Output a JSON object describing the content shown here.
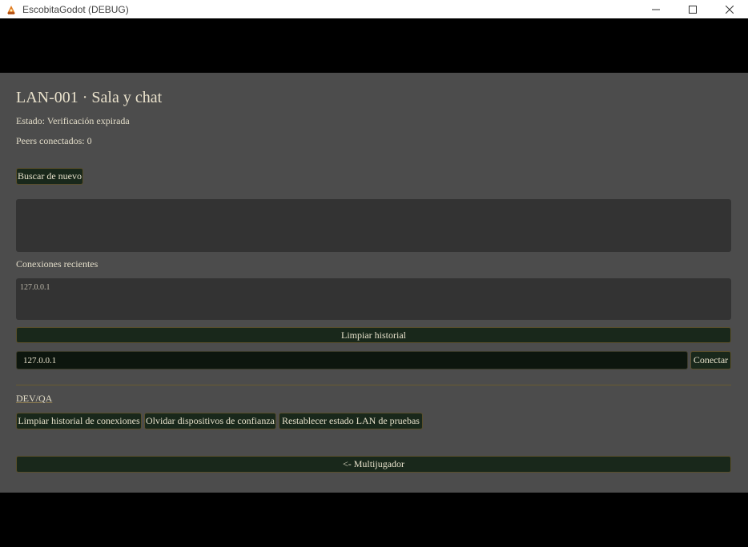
{
  "window": {
    "title": "EscobitaGodot (DEBUG)",
    "app_icon": "godot-app-icon",
    "controls": {
      "minimize": "minimize-icon",
      "maximize": "maximize-icon",
      "close": "close-icon"
    }
  },
  "lobby": {
    "title": "LAN-001 · Sala y chat",
    "status": "Estado: Verificación expirada",
    "peers": "Peers conectados: 0",
    "search_again_label": "Buscar de nuevo",
    "log_text": ""
  },
  "recent": {
    "label": "Conexiones recientes",
    "items": [
      "127.0.0.1"
    ],
    "clear_label": "Limpiar historial"
  },
  "connect": {
    "address_value": "127.0.0.1",
    "connect_label": "Conectar"
  },
  "devqa": {
    "label": "DEV/QA",
    "clear_connections_label": "Limpiar historial de conexiones",
    "forget_devices_label": "Olvidar dispositivos de confianza",
    "reset_lan_label": "Restablecer estado LAN de pruebas"
  },
  "footer": {
    "back_label": "<- Multijugador"
  },
  "colors": {
    "panel_bg": "#4c4c4c",
    "button_bg": "#19281b",
    "button_border": "#5a4f2c",
    "text": "#e6e0ca",
    "separator": "#6a5b30"
  }
}
